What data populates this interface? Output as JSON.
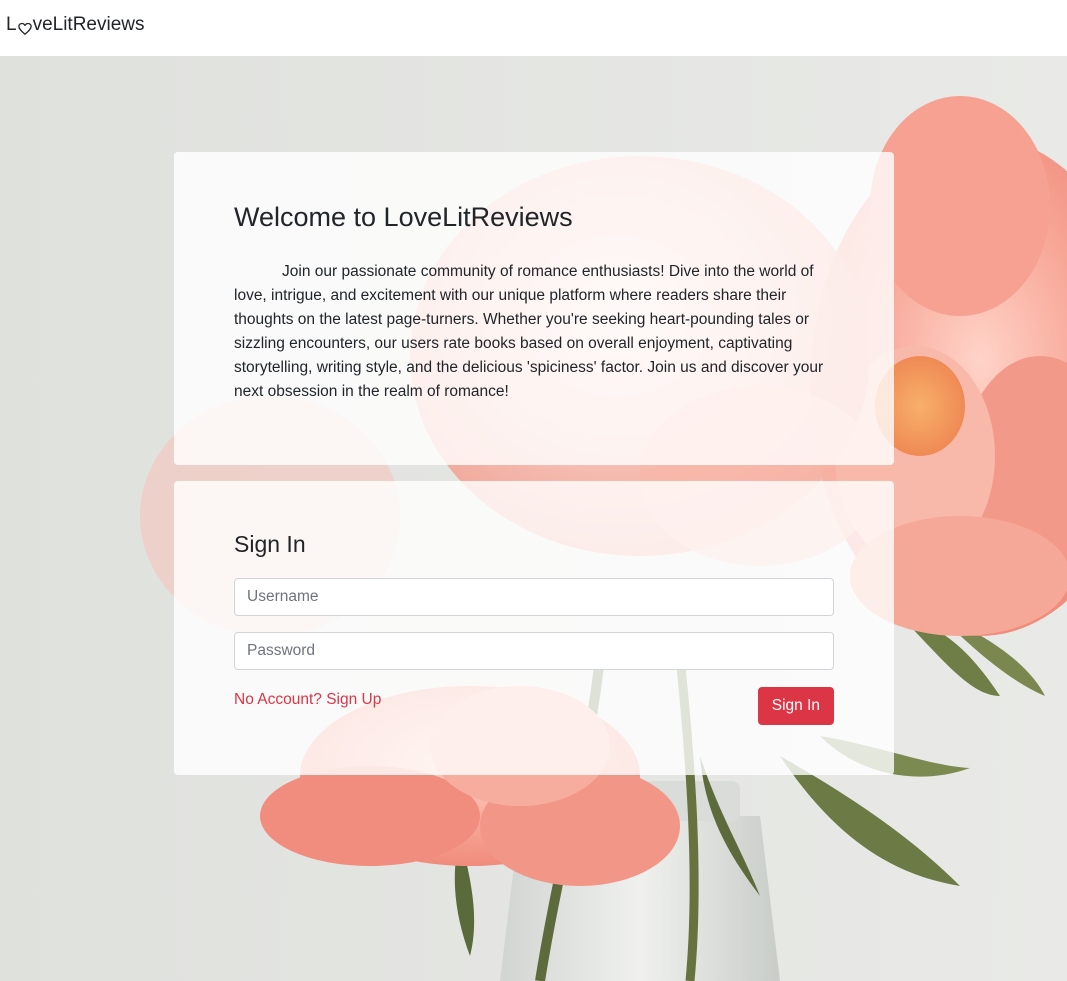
{
  "navbar": {
    "brand_prefix": "L",
    "brand_suffix": "veLitReviews",
    "brand_icon": "heart-outline-icon"
  },
  "welcome": {
    "title": "Welcome to LoveLitReviews",
    "body": "Join our passionate community of romance enthusiasts! Dive into the world of love, intrigue, and excitement with our unique platform where readers share their thoughts on the latest page-turners. Whether you're seeking heart-pounding tales or sizzling encounters, our users rate books based on overall enjoyment, captivating storytelling, writing style, and the delicious 'spiciness' factor. Join us and discover your next obsession in the realm of romance!"
  },
  "signin": {
    "title": "Sign In",
    "username_placeholder": "Username",
    "username_value": "",
    "password_placeholder": "Password",
    "password_value": "",
    "signup_link": "No Account? Sign Up",
    "submit_label": "Sign In"
  },
  "colors": {
    "accent": "#dc3545",
    "background": "#e4e6e2",
    "card": "rgba(255,255,255,0.80)"
  }
}
